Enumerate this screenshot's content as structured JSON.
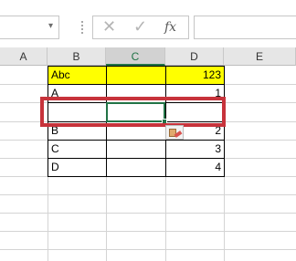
{
  "formula_bar": {
    "name_box_value": "",
    "dropdown_glyph": "▾",
    "cancel_glyph": "✕",
    "enter_glyph": "✓",
    "fx_label": "fx",
    "formula_value": ""
  },
  "columns": [
    "A",
    "B",
    "C",
    "D",
    "E"
  ],
  "active_column": "C",
  "rows": [
    {
      "b": "Abc",
      "c": "",
      "d": "123"
    },
    {
      "b": "A",
      "c": "",
      "d": "1"
    },
    {
      "b": "",
      "c": "",
      "d": ""
    },
    {
      "b": "B",
      "c": "",
      "d": "2"
    },
    {
      "b": "C",
      "c": "",
      "d": "3"
    },
    {
      "b": "D",
      "c": "",
      "d": "4"
    }
  ],
  "colors": {
    "highlight_fill": "#ffff00",
    "selection": "#217346",
    "annotation_box": "#c7333b"
  },
  "icons": {
    "paste_options": "paste-options-icon"
  }
}
